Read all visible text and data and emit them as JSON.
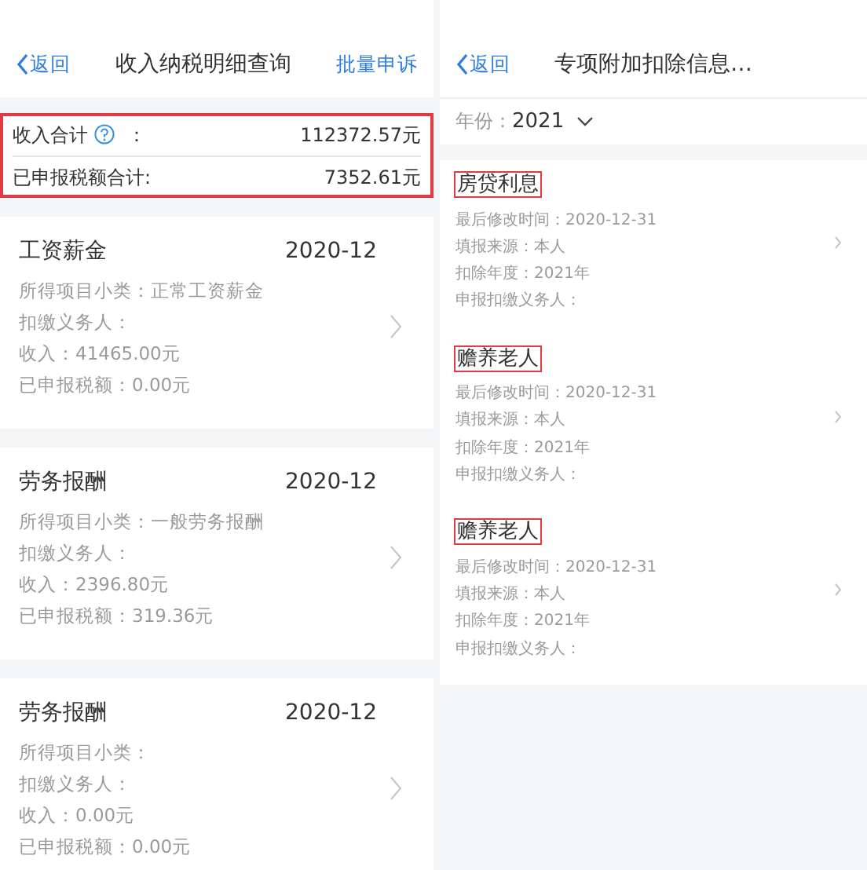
{
  "income_screen": {
    "back": "返回",
    "title": "收入纳税明细查询",
    "action": "批量申诉",
    "totals": {
      "highlighted": true,
      "rows": [
        {
          "label": "收入合计",
          "help": true,
          "colon": "：",
          "value": "112372.57元"
        },
        {
          "label": "已申报税额合计:",
          "help": false,
          "colon": "",
          "value": "7352.61元"
        }
      ]
    },
    "records": [
      {
        "title": "工资薪金",
        "period": "2020-12",
        "lines": [
          "所得项目小类：正常工资薪金",
          "扣缴义务人：",
          "收入：41465.00元",
          "已申报税额：0.00元"
        ]
      },
      {
        "title": "劳务报酬",
        "period": "2020-12",
        "lines": [
          "所得项目小类：一般劳务报酬",
          "扣缴义务人：",
          "收入：2396.80元",
          "已申报税额：319.36元"
        ]
      },
      {
        "title": "劳务报酬",
        "period": "2020-12",
        "lines": [
          "所得项目小类：",
          "扣缴义务人：",
          "收入：0.00元",
          "已申报税额：0.00元"
        ]
      }
    ]
  },
  "deduction_screen": {
    "back": "返回",
    "title": "专项附加扣除信息…",
    "year_label": "年份：",
    "year": "2021",
    "items": [
      {
        "title": "房贷利息",
        "highlighted": true,
        "lines": [
          "最后修改时间：2020-12-31",
          "填报来源：本人",
          "扣除年度：2021年",
          "申报扣缴义务人："
        ]
      },
      {
        "title": "赡养老人",
        "highlighted": true,
        "lines": [
          "最后修改时间：2020-12-31",
          "填报来源：本人",
          "扣除年度：2021年",
          "申报扣缴义务人："
        ]
      },
      {
        "title": "赡养老人",
        "highlighted": true,
        "lines": [
          "最后修改时间：2020-12-31",
          "填报来源：本人",
          "扣除年度：2021年",
          "申报扣缴义务人："
        ]
      }
    ]
  }
}
